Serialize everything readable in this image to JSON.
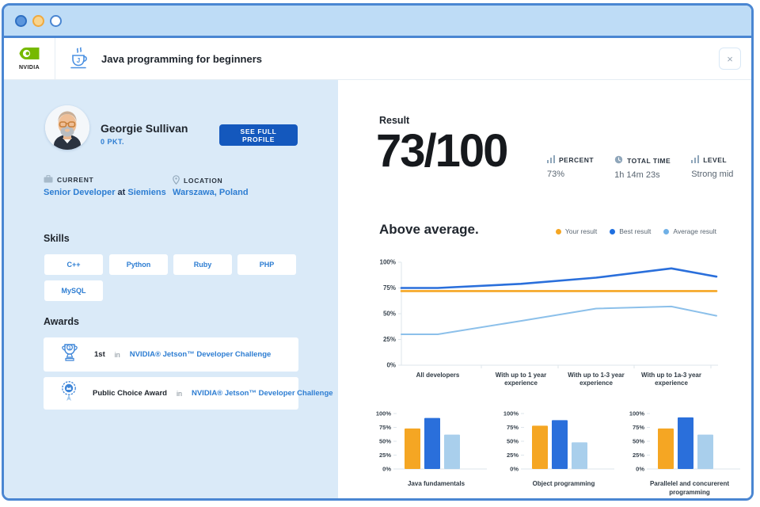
{
  "window": {
    "title": "Java programming for beginners",
    "close_label": "×"
  },
  "brand": {
    "name": "NVIDIA"
  },
  "profile": {
    "name": "Georgie Sullivan",
    "points": "0 PKT.",
    "see_full_profile": "SEE FULL PROFILE",
    "current_label": "CURRENT",
    "current_role": "Senior Developer",
    "current_connector": "at",
    "current_company": "Siemiens",
    "location_label": "LOCATION",
    "location_value": "Warszawa, Poland"
  },
  "skills": {
    "heading": "Skills",
    "items": [
      "C++",
      "Python",
      "Ruby",
      "PHP",
      "MySQL"
    ]
  },
  "awards": {
    "heading": "Awards",
    "items": [
      {
        "title": "1st",
        "connector": "in",
        "event": "NVIDIA® Jetson™ Developer Challenge"
      },
      {
        "title": "Public Choice Award",
        "connector": "in",
        "event": "NVIDIA® Jetson™ Developer Challenge"
      }
    ]
  },
  "result": {
    "heading": "Result",
    "score": "73/100",
    "stats": [
      {
        "icon": "bar-chart-icon",
        "label": "PERCENT",
        "value": "73%"
      },
      {
        "icon": "clock-icon",
        "label": "TOTAL TIME",
        "value": "1h 14m 23s"
      },
      {
        "icon": "bar-chart-icon",
        "label": "LEVEL",
        "value": "Strong mid"
      }
    ],
    "verdict": "Above average."
  },
  "legend": [
    {
      "label": "Your result",
      "color": "#F5A623"
    },
    {
      "label": "Best result",
      "color": "#1F6FE0"
    },
    {
      "label": "Average result",
      "color": "#6FB0E6"
    }
  ],
  "colors": {
    "accent_blue": "#2D7DD2",
    "button_blue": "#1458BD",
    "panel_blue": "#DAEAF8",
    "frame_blue": "#4A86D2",
    "nvidia_green": "#76B900"
  },
  "chart_data": [
    {
      "type": "line",
      "title": "Above average.",
      "categories": [
        "All developers",
        "With up to 1 year experience",
        "With up to 1-3 year experience",
        "With up to 1a-3 year experience"
      ],
      "yticks": [
        "0%",
        "25%",
        "50%",
        "75%",
        "100%"
      ],
      "ylim": [
        0,
        100
      ],
      "grid": false,
      "legend_position": "top-right",
      "points_include_edges": true,
      "series": [
        {
          "name": "Your result",
          "color": "#F5A623",
          "values": [
            72,
            72,
            72,
            72,
            72,
            72
          ]
        },
        {
          "name": "Best result",
          "color": "#2A6FDB",
          "values": [
            75,
            75,
            79,
            85,
            94,
            86
          ]
        },
        {
          "name": "Average result",
          "color": "#8CC0EA",
          "values": [
            30,
            30,
            43,
            55,
            57,
            48
          ]
        }
      ]
    },
    {
      "type": "bar",
      "title": "Java fundamentals",
      "categories": [
        "Your result",
        "Best result",
        "Average result"
      ],
      "values": [
        73,
        92,
        62
      ],
      "colors": [
        "#F5A623",
        "#2A6FDB",
        "#A9CFEC"
      ],
      "yticks": [
        "0%",
        "25%",
        "50%",
        "75%",
        "100%"
      ],
      "ylim": [
        0,
        100
      ]
    },
    {
      "type": "bar",
      "title": "Object programming",
      "categories": [
        "Your result",
        "Best result",
        "Average result"
      ],
      "values": [
        78,
        88,
        48
      ],
      "colors": [
        "#F5A623",
        "#2A6FDB",
        "#A9CFEC"
      ],
      "yticks": [
        "0%",
        "25%",
        "50%",
        "75%",
        "100%"
      ],
      "ylim": [
        0,
        100
      ]
    },
    {
      "type": "bar",
      "title": "Parallelel and concurerent programming",
      "categories": [
        "Your result",
        "Best result",
        "Average result"
      ],
      "values": [
        73,
        93,
        62
      ],
      "colors": [
        "#F5A623",
        "#2A6FDB",
        "#A9CFEC"
      ],
      "yticks": [
        "0%",
        "25%",
        "50%",
        "75%",
        "100%"
      ],
      "ylim": [
        0,
        100
      ]
    }
  ]
}
